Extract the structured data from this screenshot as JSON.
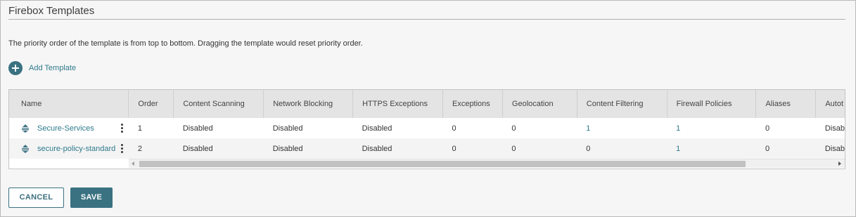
{
  "page": {
    "title": "Firebox Templates",
    "description": "The priority order of the template is from top to bottom. Dragging the template would reset priority order."
  },
  "actions": {
    "add_template_label": "Add Template",
    "cancel_label": "CANCEL",
    "save_label": "SAVE"
  },
  "colors": {
    "accent": "#3a7281",
    "link": "#2e7a8c",
    "header_bg": "#e4e4e4"
  },
  "table": {
    "columns": [
      "Name",
      "Order",
      "Content Scanning",
      "Network Blocking",
      "HTTPS Exceptions",
      "Exceptions",
      "Geolocation",
      "Content Filtering",
      "Firewall Policies",
      "Aliases",
      "Autot"
    ],
    "rows": [
      {
        "name": "Secure-Services",
        "order": "1",
        "content_scanning": "Disabled",
        "network_blocking": "Disabled",
        "https_exceptions": "Disabled",
        "exceptions": "0",
        "geolocation": "0",
        "content_filtering": "1",
        "firewall_policies": "1",
        "aliases": "0",
        "auto": "Disab"
      },
      {
        "name": "secure-policy-standard",
        "order": "2",
        "content_scanning": "Disabled",
        "network_blocking": "Disabled",
        "https_exceptions": "Disabled",
        "exceptions": "0",
        "geolocation": "0",
        "content_filtering": "0",
        "firewall_policies": "1",
        "aliases": "0",
        "auto": "Disab"
      }
    ]
  }
}
